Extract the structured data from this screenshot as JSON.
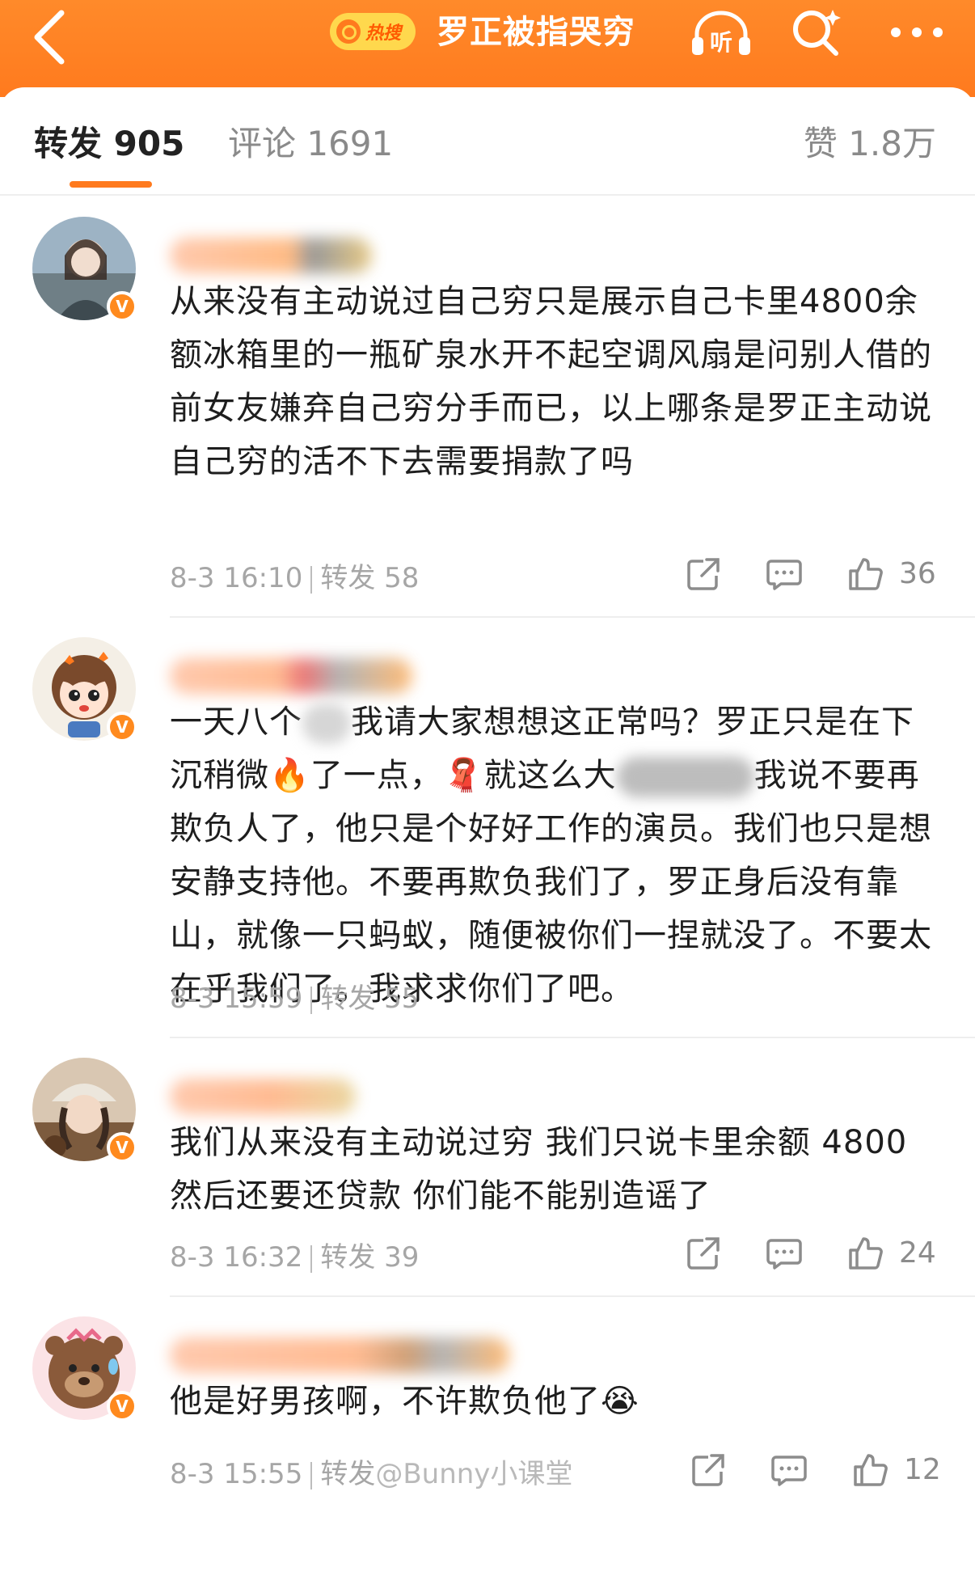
{
  "header": {
    "hot_label": "热搜",
    "topic_title": "罗正被指哭穷",
    "listen_label": "听"
  },
  "tabs": {
    "repost": "转发 905",
    "comments": "评论 1691",
    "likes": "赞 1.8万"
  },
  "comments": [
    {
      "text": "从来没有主动说过自己穷只是展示自己卡里4800余额冰箱里的一瓶矿泉水开不起空调风扇是问别人借的前女友嫌弃自己穷分手而已，以上哪条是罗正主动说自己穷的活不下去需要捐款了吗",
      "time": "8-3 16:10",
      "repost": "转发 58",
      "likes": "36"
    },
    {
      "text_parts": {
        "p1": "一天八个",
        "p2": "我请大家想想这正常吗？罗正只是在下沉稍微",
        "p3": "了一点，",
        "p4": "就这么大",
        "p5": "我说不要再欺负人了，他只是个好好工作的演员。我们也只是想安静支持他。不要再欺负我们了，罗正身后没有靠山，就像一只蚂蚁，随便被你们一捏就没了。不要太在乎我们了。我求求你们了吧。"
      },
      "time": "8-3 15:59",
      "repost": "转发 55"
    },
    {
      "text": "我们从来没有主动说过穷 我们只说卡里余额 4800 然后还要还贷款 你们能不能别造谣了",
      "time": "8-3 16:32",
      "repost": "转发 39",
      "likes": "24"
    },
    {
      "text": "他是好男孩啊，不许欺负他了",
      "time": "8-3 15:55",
      "repost": "转发",
      "watermark": "@Bunny小课堂",
      "likes": "12"
    }
  ],
  "emoji": {
    "fire": "🔥",
    "scarf": "🧣",
    "crying": "😭"
  },
  "colors": {
    "brand_orange": "#ff7a1e",
    "hot_yellow": "#ffd84d",
    "text_gray": "#a6a6a6"
  }
}
